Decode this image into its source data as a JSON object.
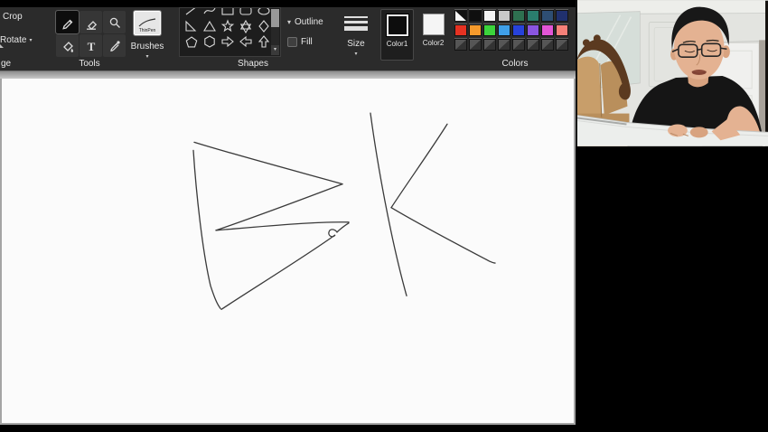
{
  "app": {
    "toolbar": {
      "image_group": {
        "group_label": "ge",
        "crop_label": "Crop",
        "rotate_label": "Rotate"
      },
      "tools_group": {
        "group_label": "Tools",
        "tool_names": [
          "pencil",
          "eraser",
          "magnifier",
          "fill-bucket",
          "text",
          "eyedropper"
        ],
        "selected_tool": "pencil"
      },
      "brushes_group": {
        "brushes_label": "Brushes",
        "selected_brush_label": "ThinPen"
      },
      "shapes_group": {
        "group_label": "Shapes",
        "outline_label": "Outline",
        "fill_label": "Fill",
        "shape_names": [
          "line",
          "curve",
          "rectangle",
          "rounded-rectangle",
          "ellipse",
          "right-triangle",
          "triangle",
          "star",
          "six-point-star",
          "diamond",
          "pentagon",
          "hexagon",
          "arrow-right",
          "arrow-left",
          "arrow-up"
        ]
      },
      "size_group": {
        "size_label": "Size"
      },
      "color_group": {
        "color1_label": "Color1",
        "color2_label": "Color2",
        "color1_value": "#0d0d0d",
        "color2_value": "#f5f5f5",
        "colors_label": "Colors",
        "palette": {
          "row1": [
            "split-black-white",
            "#0f0f0f",
            "#f4f4f4",
            "#c9c9c9",
            "#2e7050",
            "#2a7d6e",
            "#2e4e73",
            "#20306e"
          ],
          "row2": [
            "#e63222",
            "#f59a2c",
            "#3cd43c",
            "#3f9fe8",
            "#2742da",
            "#8a55e0",
            "#e255d6",
            "#f58078"
          ],
          "row3": [
            "empty",
            "empty",
            "empty",
            "empty",
            "empty",
            "empty",
            "empty",
            "empty"
          ]
        }
      }
    },
    "canvas": {
      "drawing_label": "freehand letters BK",
      "stroke_color": "#3a3a3a",
      "strokes": [
        "M212,79 C215,125 222,190 231,228 C235,240 238,248 242,253",
        "M213,70 C255,83 330,103 377,116",
        "M377,116 C340,130 272,155 237,167",
        "M237,167 C285,163 348,157 384,158",
        "M384,159 C379,162 374,166 371,169 C368,165 363,165 362,169 C361,173 366,176 369,172 C340,193 278,231 243,254",
        "M408,38 C415,90 430,175 448,239",
        "M493,50 C476,77 448,116 431,142",
        "M431,142 C463,161 513,187 536,199 C541,202 545,203 546,203"
      ]
    }
  },
  "webcam": {
    "scene": "presenter in black t-shirt with glasses at white desk, tan sofa and white door behind",
    "colors": {
      "wall": "#e3e4e0",
      "ceiling": "#edeeea",
      "mirror": "#d6ded9",
      "door": "#f0f0ee",
      "jamb": "#a8a29a",
      "sofa_wood": "#5b3a20",
      "sofa_leather": "#c89e6a",
      "sofa_dark": "#b98f5c",
      "shirt": "#151515",
      "hair": "#181818",
      "skin": "#e4b292",
      "skin_dark": "#d8a380",
      "desk": "#eceeec"
    }
  }
}
